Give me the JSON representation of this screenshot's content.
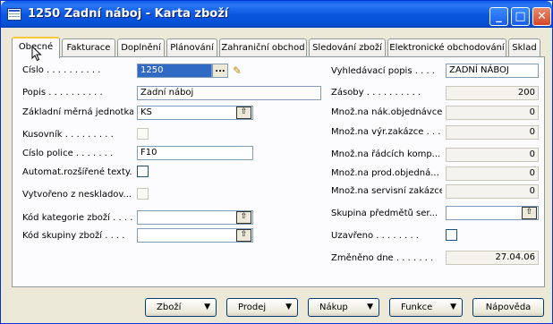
{
  "window": {
    "title": "1250 Zadní náboj - Karta zboží",
    "minimize": "_",
    "maximize": "□",
    "close": "✕"
  },
  "tabs": [
    "Obecné",
    "Fakturace",
    "Doplnění",
    "Plánování",
    "Zahraniční obchod",
    "Sledování zboží",
    "Elektronické obchodování",
    "Sklad"
  ],
  "left": {
    "cislo": {
      "label": "Číslo . . . . . . . . . .",
      "value": "1250"
    },
    "popis": {
      "label": "Popis . . . . . . . . . .",
      "value": "Zadní náboj"
    },
    "jednotka": {
      "label": "Základní měrná jednotka. .",
      "value": "KS"
    },
    "kusovnik": {
      "label": "Kusovník . . . . . . . . ."
    },
    "police": {
      "label": "Číslo police . . . . . . .",
      "value": "F10"
    },
    "automat": {
      "label": "Automat.rozšířené texty. ."
    },
    "vytvoreno": {
      "label": "Vytvořeno z neskladov..."
    },
    "kategorie": {
      "label": "Kód kategorie zboží . . . .",
      "value": ""
    },
    "skupina": {
      "label": "Kód skupiny zboží . . . .",
      "value": ""
    }
  },
  "right": {
    "vyhledavaci": {
      "label": "Vyhledávací popis . . . .",
      "value": "ZADNÍ NÁBOJ"
    },
    "zasoby": {
      "label": "Zásoby . . . . . . . . . .",
      "value": "200"
    },
    "nak": {
      "label": "Množ.na nák.objednávce",
      "value": "0"
    },
    "vyr": {
      "label": "Množ.na výr.zakázce . . .",
      "value": "0"
    },
    "radcich": {
      "label": "Množ.na řádcích komp...",
      "value": "0"
    },
    "prod": {
      "label": "Množ.na prod.objedná...",
      "value": "0"
    },
    "servis": {
      "label": "Množ.na servisní zakázce",
      "value": "0"
    },
    "skupina_predmetu": {
      "label": "Skupina předmětů ser...",
      "value": ""
    },
    "uzavreno": {
      "label": "Uzavřeno . . . . . . . ."
    },
    "zmeneno": {
      "label": "Změněno dne . . . . . . .",
      "value": "27.04.06"
    }
  },
  "buttons": {
    "zbozi": "Zboží",
    "prodej": "Prodej",
    "nakup": "Nákup",
    "funkce": "Funkce",
    "napoveda": "Nápověda"
  },
  "icons": {
    "lookup": "⇧",
    "dots": "...",
    "edit": "✎",
    "dropdown": "▼"
  }
}
